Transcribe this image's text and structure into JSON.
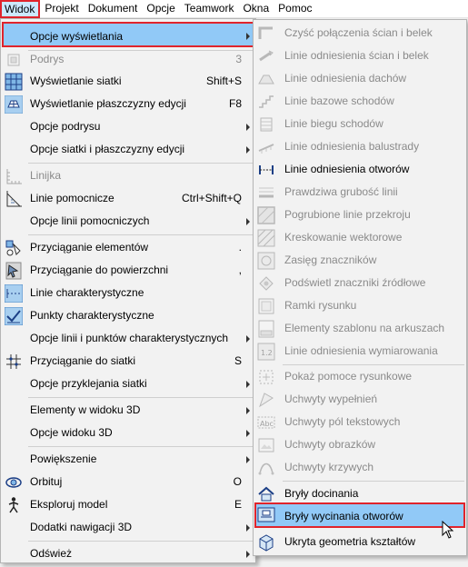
{
  "menubar": {
    "items": [
      "Widok",
      "Projekt",
      "Dokument",
      "Opcje",
      "Teamwork",
      "Okna",
      "Pomoc"
    ]
  },
  "main_menu": {
    "items": [
      {
        "label": "Opcje wyświetlania",
        "icon": "none"
      },
      {
        "label": "Podrys",
        "shortcut": "3",
        "icon": "trace-icon"
      },
      {
        "label": "Wyświetlanie siatki",
        "shortcut": "Shift+S",
        "icon": "grid-icon"
      },
      {
        "label": "Wyświetlanie płaszczyzny edycji",
        "shortcut": "F8",
        "icon": "editing-plane-icon"
      },
      {
        "label": "Opcje podrysu"
      },
      {
        "label": "Opcje siatki i płaszczyzny edycji"
      },
      {
        "label": "Linijka",
        "icon": "ruler-icon"
      },
      {
        "label": "Linie pomocnicze",
        "shortcut": "Ctrl+Shift+Q",
        "icon": "guide-lines-icon"
      },
      {
        "label": "Opcje linii pomocniczych"
      },
      {
        "label": "Przyciąganie elementów",
        "shortcut": ".",
        "icon": "snap-elements-icon"
      },
      {
        "label": "Przyciąganie do powierzchni",
        "shortcut": ",",
        "icon": "snap-surface-icon"
      },
      {
        "label": "Linie charakterystyczne",
        "icon": "special-lines-icon"
      },
      {
        "label": "Punkty charakterystyczne",
        "icon": "special-points-icon"
      },
      {
        "label": "Opcje linii i punktów charakterystycznych"
      },
      {
        "label": "Przyciąganie do siatki",
        "shortcut": "S",
        "icon": "grid-snap-icon"
      },
      {
        "label": "Opcje przyklejania siatki"
      },
      {
        "label": "Elementy w widoku 3D"
      },
      {
        "label": "Opcje widoku 3D"
      },
      {
        "label": "Powiększenie"
      },
      {
        "label": "Orbituj",
        "shortcut": "O",
        "icon": "orbit-icon"
      },
      {
        "label": "Eksploruj model",
        "shortcut": "E",
        "icon": "explore-icon"
      },
      {
        "label": "Dodatki nawigacji 3D"
      },
      {
        "label": "Odśwież"
      }
    ]
  },
  "sub_menu": {
    "items": [
      {
        "label": "Czyść połączenia ścian i belek",
        "icon": "clean-joins-icon"
      },
      {
        "label": "Linie odniesienia ścian i belek",
        "icon": "wall-reference-icon"
      },
      {
        "label": "Linie odniesienia dachów",
        "icon": "roof-reference-icon"
      },
      {
        "label": "Linie bazowe schodów",
        "icon": "stair-baseline-icon"
      },
      {
        "label": "Linie biegu schodów",
        "icon": "stair-walking-line-icon"
      },
      {
        "label": "Linie odniesienia balustrady",
        "icon": "railing-reference-icon"
      },
      {
        "label": "Linie odniesienia otworów",
        "icon": "opening-reference-icon"
      },
      {
        "label": "Prawdziwa grubość linii",
        "icon": "true-line-weight-icon"
      },
      {
        "label": "Pogrubione linie przekroju",
        "icon": "bold-cut-lines-icon"
      },
      {
        "label": "Kreskowanie wektorowe",
        "icon": "vector-hatching-icon"
      },
      {
        "label": "Zasięg znaczników",
        "icon": "marker-range-icon"
      },
      {
        "label": "Podświetl znaczniki źródłowe",
        "icon": "source-markers-icon"
      },
      {
        "label": "Ramki rysunku",
        "icon": "drawing-frames-icon"
      },
      {
        "label": "Elementy szablonu na arkuszach",
        "icon": "master-items-icon"
      },
      {
        "label": "Linie odniesienia wymiarowania",
        "icon": "dimension-reference-icon"
      },
      {
        "label": "Pokaż pomoce rysunkowe",
        "icon": "drawing-aids-icon"
      },
      {
        "label": "Uchwyty wypełnień",
        "icon": "fill-handles-icon"
      },
      {
        "label": "Uchwyty pól tekstowych",
        "icon": "text-handles-icon"
      },
      {
        "label": "Uchwyty obrazków",
        "icon": "image-handles-icon"
      },
      {
        "label": "Uchwyty krzywych",
        "icon": "curve-handles-icon"
      },
      {
        "label": "Bryły docinania",
        "icon": "trimming-bodies-icon"
      },
      {
        "label": "Bryły wycinania otworów",
        "icon": "opening-cut-bodies-icon"
      },
      {
        "label": "Ukryta geometria kształtów",
        "icon": "hidden-geometry-icon"
      }
    ]
  }
}
